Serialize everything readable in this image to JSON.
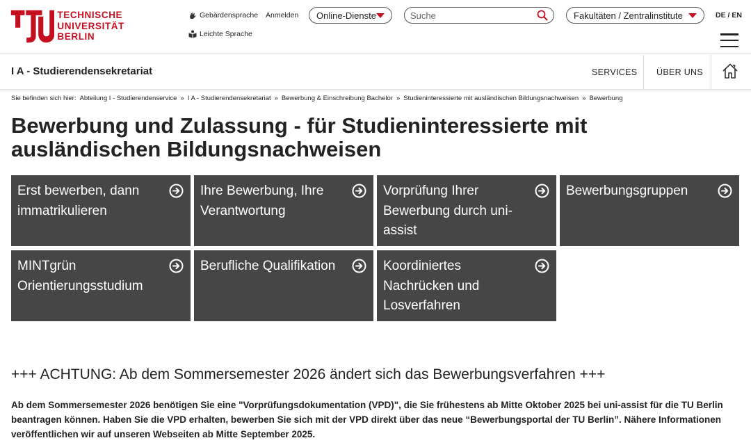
{
  "logo": {
    "line1": "TECHNISCHE",
    "line2": "UNIVERSITÄT",
    "line3": "BERLIN"
  },
  "header": {
    "sign_language": "Gebärdensprache",
    "login": "Anmelden",
    "easy_language": "Leichte Sprache",
    "online_services": "Online-Dienste",
    "search_placeholder": "Suche",
    "faculties": "Fakultäten / Zentralinstitute",
    "lang": "DE / EN"
  },
  "section": {
    "title": "I A - Studierendensekretariat",
    "nav": [
      "SERVICES",
      "ÜBER UNS"
    ]
  },
  "breadcrumb": {
    "prefix": "Sie befinden sich hier:",
    "items": [
      "Abteilung I - Studierendenservice",
      "I A - Studierendensekretariat",
      "Bewerbung & Einschreibung Bachelor",
      "Studieninteressierte mit ausländischen Bildungsnachweisen",
      "Bewerbung"
    ],
    "separator": "»"
  },
  "page_title": "Bewerbung und Zulassung - für Studieninteressierte mit ausländischen Bildungsnachweisen",
  "tiles": [
    "Erst bewerben, dann immatrikulieren",
    "Ihre Bewerbung, Ihre Verantwortung",
    "Vorprüfung Ihrer Bewerbung durch uni-assist",
    "Bewerbungsgruppen",
    "MINTgrün Orientierungsstudium",
    "Berufliche Qualifikation",
    "Koordiniertes Nachrücken und Losverfahren"
  ],
  "notice": {
    "heading": "+++ ACHTUNG: Ab dem Sommersemester 2026 ändert sich das Bewerbungsverfahren +++",
    "text": "Ab dem Sommersemester 2026 benötigen Sie eine \"Vorprüfungsdokumentation (VPD)\", die Sie frühestens ab Mitte Oktober 2025 bei uni-assist für die TU Berlin beantragen können. Haben Sie die VPD erhalten, bewerben Sie sich mit der VPD direkt über das neue “Bewerbungsportal der TU Berlin”. Nähere Informationen veröffentlichen wir auf unseren Webseiten ab Mitte September 2025."
  },
  "colors": {
    "brand_red": "#c50e1f",
    "tile_bg": "#464646"
  }
}
